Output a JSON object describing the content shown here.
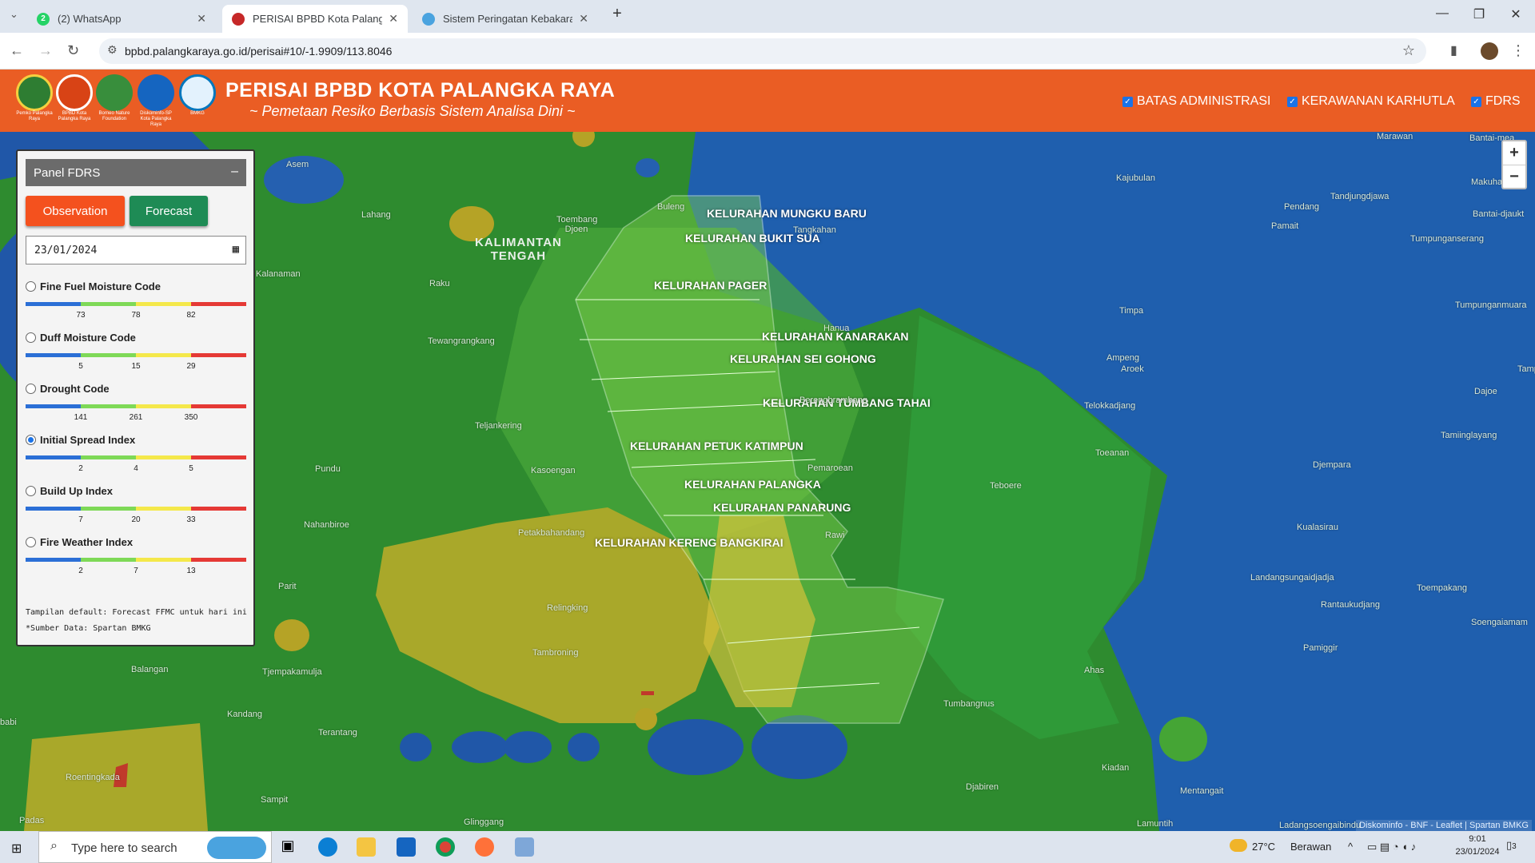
{
  "browser": {
    "tabs": [
      {
        "title": "(2) WhatsApp",
        "icon": "whatsapp-icon",
        "active": false
      },
      {
        "title": "PERISAI BPBD Kota Palangka Ra",
        "icon": "bpbd-icon",
        "active": true
      },
      {
        "title": "Sistem Peringatan Kebakaran H",
        "icon": "bmkg-icon",
        "active": false
      }
    ],
    "url": "bpbd.palangkaraya.go.id/perisai#10/-1.9909/113.8046"
  },
  "header": {
    "title": "PERISAI BPBD KOTA PALANGKA RAYA",
    "subtitle": "~ Pemetaan Resiko Berbasis Sistem Analisa Dini ~",
    "logos": [
      {
        "caption": "Pemko Palangka Raya",
        "color": "#2e7d32"
      },
      {
        "caption": "BPBD Kota Palangka Raya",
        "color": "#d84315"
      },
      {
        "caption": "Borneo Nature Foundation",
        "color": "#388e3c"
      },
      {
        "caption": "Diskominfo-SP Kota Palangka Raya",
        "color": "#1565c0"
      },
      {
        "caption": "BMKG",
        "color": "#0277bd"
      }
    ],
    "layers": [
      "BATAS ADMINISTRASI",
      "KERAWANAN KARHUTLA",
      "FDRS"
    ]
  },
  "panel": {
    "title": "Panel FDRS",
    "observation_label": "Observation",
    "forecast_label": "Forecast",
    "date_value": "23/01/2024",
    "indices": [
      {
        "label": "Fine Fuel Moisture Code",
        "ticks": [
          "73",
          "78",
          "82"
        ],
        "selected": false
      },
      {
        "label": "Duff Moisture Code",
        "ticks": [
          "5",
          "15",
          "29"
        ],
        "selected": false
      },
      {
        "label": "Drought Code",
        "ticks": [
          "141",
          "261",
          "350"
        ],
        "selected": false
      },
      {
        "label": "Initial Spread Index",
        "ticks": [
          "2",
          "4",
          "5"
        ],
        "selected": true
      },
      {
        "label": "Build Up Index",
        "ticks": [
          "7",
          "20",
          "33"
        ],
        "selected": false
      },
      {
        "label": "Fire Weather Index",
        "ticks": [
          "2",
          "7",
          "13"
        ],
        "selected": false
      }
    ],
    "scale_colors": [
      "#2b6fd6",
      "#7ed957",
      "#f4e84a",
      "#e53935"
    ],
    "note1": "Tampilan default: Forecast FFMC untuk hari ini",
    "note2": "*Sumber Data: Spartan BMKG"
  },
  "map": {
    "province_label": "KALIMANTAN\nTENGAH",
    "kelurahan": [
      "KELURAHAN MUNGKU BARU",
      "KELURAHAN BUKIT SUA",
      "KELURAHAN PAGER",
      "KELURAHAN KANARAKAN",
      "KELURAHAN SEI GOHONG",
      "KELURAHAN TUMBANG TAHAI",
      "KELURAHAN PETUK KATIMPUN",
      "KELURAHAN PALANGKA",
      "KELURAHAN PANARUNG",
      "KELURAHAN KERENG BANGKIRAI"
    ],
    "places": [
      "Asem",
      "Lahang",
      "Toembang Djoen",
      "Buleng",
      "Tangkahan",
      "Kalanaman",
      "Raku",
      "Tewangrangkang",
      "Hanua",
      "Berengbrambang",
      "Teljankering",
      "Pundu",
      "Kasoengan",
      "Pemaroean",
      "Nahanbiroe",
      "Petakbahandang",
      "Rawi",
      "Parit",
      "Relingking",
      "Tambroning",
      "Balangan",
      "Tjempakamulja",
      "Kandang",
      "Terantang",
      "Roentingkada",
      "Sampit",
      "Padas",
      "Glinggang",
      "Teboere",
      "Ampeng",
      "Aroek",
      "Timpa",
      "Telokkadjang",
      "Toeanan",
      "Ahas",
      "Tumbangnus",
      "Djabiren",
      "Kiadan",
      "Mentangait",
      "Lamuntih",
      "Marawan",
      "Bantai-mea",
      "Kajubulan",
      "Pendang",
      "Makuhadji",
      "Tandjungdjawa",
      "Pamait",
      "Bantai-djaukt",
      "Tumpunganserang",
      "Tumpunganmuara",
      "Tamp",
      "Dajoe",
      "Tamiinglayang",
      "Djempara",
      "Kualasirau",
      "Landangsungaidjadja",
      "Toempakang",
      "Rantaukudjang",
      "Soengaiamam",
      "Pamiggir",
      "Ladangsoengaibindu",
      "babi"
    ],
    "attribution": "Diskominfo - BNF - Leaflet | Spartan BMKG",
    "zoom_in": "+",
    "zoom_out": "−"
  },
  "taskbar": {
    "search_placeholder": "Type here to search",
    "temperature": "27°C",
    "weather": "Berawan",
    "time": "9:01",
    "date": "23/01/2024",
    "notification_count": "3"
  }
}
